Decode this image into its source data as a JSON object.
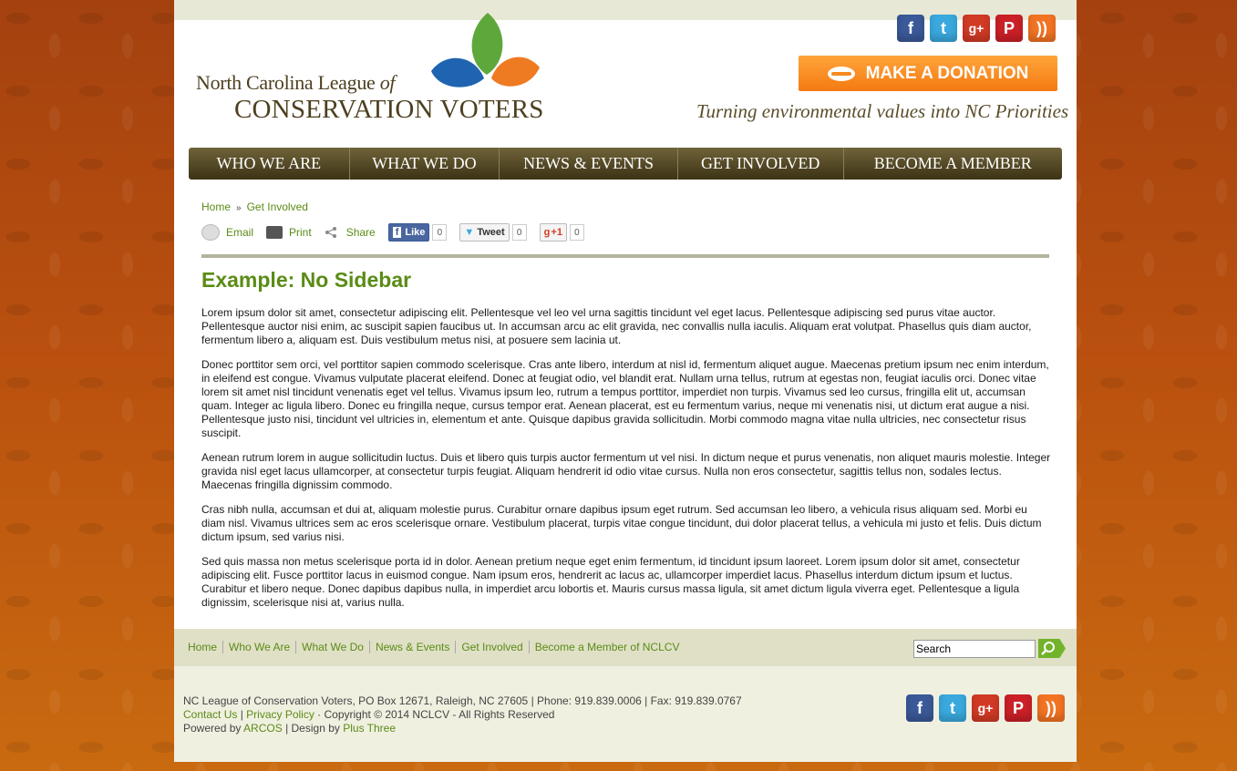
{
  "header": {
    "logo_line1_a": "North Carolina League ",
    "logo_line1_b": "of",
    "logo_line2": "CONSERVATION VOTERS",
    "donate_label": "MAKE A DONATION",
    "tagline": "Turning environmental values into NC Priorities",
    "social": [
      "facebook-icon",
      "twitter-icon",
      "google-plus-icon",
      "pinterest-icon",
      "rss-icon"
    ]
  },
  "nav": {
    "items": [
      "WHO WE ARE",
      "WHAT WE DO",
      "NEWS & EVENTS",
      "GET INVOLVED",
      "BECOME A MEMBER"
    ]
  },
  "breadcrumb": {
    "home": "Home",
    "sep": "»",
    "current": "Get Involved"
  },
  "tools": {
    "email": "Email",
    "print": "Print",
    "share": "Share",
    "like": "Like",
    "like_count": "0",
    "tweet": "Tweet",
    "tweet_count": "0",
    "plusone": "+1",
    "plusone_count": "0"
  },
  "page_title": "Example: No Sidebar",
  "paragraphs": [
    "Lorem ipsum dolor sit amet, consectetur adipiscing elit. Pellentesque vel leo vel urna sagittis tincidunt vel eget lacus. Pellentesque adipiscing sed purus vitae auctor. Pellentesque auctor nisi enim, ac suscipit sapien faucibus ut. In accumsan arcu ac elit gravida, nec convallis nulla iaculis. Aliquam erat volutpat. Phasellus quis diam auctor, fermentum libero a, aliquam est. Duis vestibulum metus nisi, at posuere sem lacinia ut.",
    "Donec porttitor sem orci, vel porttitor sapien commodo scelerisque. Cras ante libero, interdum at nisl id, fermentum aliquet augue. Maecenas pretium ipsum nec enim interdum, in eleifend est congue. Vivamus vulputate placerat eleifend. Donec at feugiat odio, vel blandit erat. Nullam urna tellus, rutrum at egestas non, feugiat iaculis orci. Donec vitae lorem sit amet nisl tincidunt venenatis eget vel tellus. Vivamus ipsum leo, rutrum a tempus porttitor, imperdiet non turpis. Vivamus sed leo cursus, fringilla elit ut, accumsan quam. Integer ac ligula libero. Donec eu fringilla neque, cursus tempor erat. Aenean placerat, est eu fermentum varius, neque mi venenatis nisi, ut dictum erat augue a nisi. Pellentesque justo nisi, tincidunt vel ultricies in, elementum et ante. Quisque dapibus gravida sollicitudin. Morbi commodo magna vitae nulla ultricies, nec consectetur risus suscipit.",
    "Aenean rutrum lorem in augue sollicitudin luctus. Duis et libero quis turpis auctor fermentum ut vel nisi. In dictum neque et purus venenatis, non aliquet mauris molestie. Integer gravida nisl eget lacus ullamcorper, at consectetur turpis feugiat. Aliquam hendrerit id odio vitae cursus. Nulla non eros consectetur, sagittis tellus non, sodales lectus. Maecenas fringilla dignissim commodo.",
    "Cras nibh nulla, accumsan et dui at, aliquam molestie purus. Curabitur ornare dapibus ipsum eget rutrum. Sed accumsan leo libero, a vehicula risus aliquam sed. Morbi eu diam nisl. Vivamus ultrices sem ac eros scelerisque ornare. Vestibulum placerat, turpis vitae congue tincidunt, dui dolor placerat tellus, a vehicula mi justo et felis. Duis dictum dictum ipsum, sed varius nisi.",
    "Sed quis massa non metus scelerisque porta id in dolor. Aenean pretium neque eget enim fermentum, id tincidunt ipsum laoreet. Lorem ipsum dolor sit amet, consectetur adipiscing elit. Fusce porttitor lacus in euismod congue. Nam ipsum eros, hendrerit ac lacus ac, ullamcorper imperdiet lacus. Phasellus interdum dictum ipsum et luctus. Curabitur et libero neque. Donec dapibus dapibus nulla, in imperdiet arcu lobortis et. Mauris cursus massa ligula, sit amet dictum ligula viverra eget. Pellentesque a ligula dignissim, scelerisque nisi at, varius nulla."
  ],
  "footer_nav": {
    "links": [
      "Home",
      "Who We Are",
      "What We Do",
      "News & Events",
      "Get Involved",
      "Become a Member of NCLCV"
    ],
    "search_value": "Search"
  },
  "footer": {
    "address": "NC League of Conservation Voters, PO Box 12671, Raleigh, NC 27605 | Phone: 919.839.0006 | Fax: 919.839.0767",
    "contact": "Contact Us",
    "pipe1": " | ",
    "privacy": "Privacy Policy",
    "copyright": " · Copyright © 2014 NCLCV - All Rights Reserved",
    "powered_by": "Powered by ",
    "arcos": "ARCOS",
    "design_by": " | Design by ",
    "plus_three": "Plus Three"
  },
  "colors": {
    "accent_green": "#5a8c15",
    "nav_brown": "#4a3f1e",
    "donate_orange": "#f58a1e",
    "background_orange": "#b9500f"
  }
}
